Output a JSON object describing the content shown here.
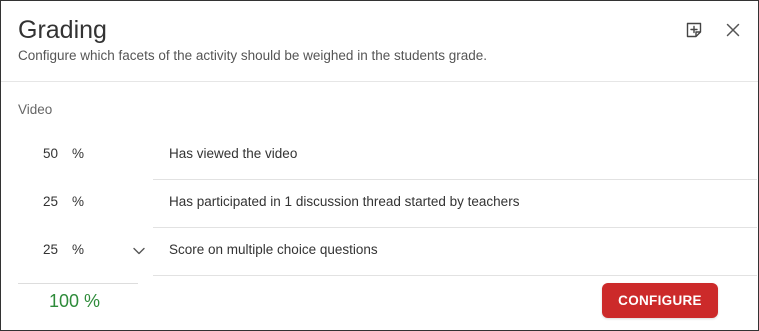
{
  "dialog": {
    "title": "Grading",
    "subtitle": "Configure which facets of the activity should be weighed in the students grade.",
    "note_icon": "note-add-icon",
    "close_icon": "close-icon"
  },
  "section": {
    "label": "Video"
  },
  "criteria": [
    {
      "value": "50",
      "unit": "%",
      "description": "Has viewed the video"
    },
    {
      "value": "25",
      "unit": "%",
      "description": "Has participated in 1 discussion thread started by teachers"
    },
    {
      "value": "25",
      "unit": "%",
      "description": "Score on multiple choice questions",
      "has_expand": true
    }
  ],
  "total": {
    "value": "100 %",
    "color": "#2e8b3a"
  },
  "actions": {
    "configure_label": "CONFIGURE",
    "configure_color": "#cc2a2a"
  }
}
